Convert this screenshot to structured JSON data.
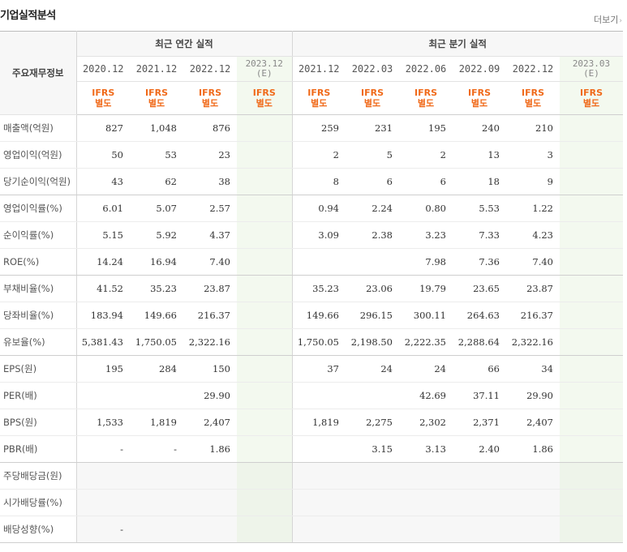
{
  "header": {
    "title": "기업실적분석",
    "more_label": "더보기"
  },
  "table": {
    "label_header": "주요재무정보",
    "annual_group": "최근 연간 실적",
    "quarter_group": "최근 분기 실적",
    "annual_dates": [
      "2020.12",
      "2021.12",
      "2022.12"
    ],
    "annual_est": [
      "2023.12",
      "(E)"
    ],
    "quarter_dates": [
      "2021.12",
      "2022.03",
      "2022.06",
      "2022.09",
      "2022.12"
    ],
    "quarter_est": [
      "2023.03",
      "(E)"
    ],
    "ifrs": [
      "IFRS",
      "별도"
    ],
    "rows": [
      {
        "label": "매출액(억원)",
        "values": [
          "827",
          "1,048",
          "876",
          "",
          "259",
          "231",
          "195",
          "240",
          "210",
          ""
        ]
      },
      {
        "label": "영업이익(억원)",
        "values": [
          "50",
          "53",
          "23",
          "",
          "2",
          "5",
          "2",
          "13",
          "3",
          ""
        ]
      },
      {
        "label": "당기순이익(억원)",
        "values": [
          "43",
          "62",
          "38",
          "",
          "8",
          "6",
          "6",
          "18",
          "9",
          ""
        ]
      },
      {
        "label": "영업이익률(%)",
        "values": [
          "6.01",
          "5.07",
          "2.57",
          "",
          "0.94",
          "2.24",
          "0.80",
          "5.53",
          "1.22",
          ""
        ]
      },
      {
        "label": "순이익률(%)",
        "values": [
          "5.15",
          "5.92",
          "4.37",
          "",
          "3.09",
          "2.38",
          "3.23",
          "7.33",
          "4.23",
          ""
        ]
      },
      {
        "label": "ROE(%)",
        "values": [
          "14.24",
          "16.94",
          "7.40",
          "",
          "",
          "",
          "7.98",
          "7.36",
          "7.40",
          ""
        ]
      },
      {
        "label": "부채비율(%)",
        "values": [
          "41.52",
          "35.23",
          "23.87",
          "",
          "35.23",
          "23.06",
          "19.79",
          "23.65",
          "23.87",
          ""
        ]
      },
      {
        "label": "당좌비율(%)",
        "values": [
          "183.94",
          "149.66",
          "216.37",
          "",
          "149.66",
          "296.15",
          "300.11",
          "264.63",
          "216.37",
          ""
        ]
      },
      {
        "label": "유보율(%)",
        "values": [
          "5,381.43",
          "1,750.05",
          "2,322.16",
          "",
          "1,750.05",
          "2,198.50",
          "2,222.35",
          "2,288.64",
          "2,322.16",
          ""
        ]
      },
      {
        "label": "EPS(원)",
        "values": [
          "195",
          "284",
          "150",
          "",
          "37",
          "24",
          "24",
          "66",
          "34",
          ""
        ]
      },
      {
        "label": "PER(배)",
        "values": [
          "",
          "",
          "29.90",
          "",
          "",
          "",
          "42.69",
          "37.11",
          "29.90",
          ""
        ]
      },
      {
        "label": "BPS(원)",
        "values": [
          "1,533",
          "1,819",
          "2,407",
          "",
          "1,819",
          "2,275",
          "2,302",
          "2,371",
          "2,407",
          ""
        ]
      },
      {
        "label": "PBR(배)",
        "values": [
          "-",
          "-",
          "1.86",
          "",
          "",
          "3.15",
          "3.13",
          "2.40",
          "1.86",
          ""
        ]
      },
      {
        "label": "주당배당금(원)",
        "values": [
          "",
          "",
          "",
          "",
          "",
          "",
          "",
          "",
          "",
          ""
        ]
      },
      {
        "label": "시가배당률(%)",
        "values": [
          "",
          "",
          "",
          "",
          "",
          "",
          "",
          "",
          "",
          ""
        ]
      },
      {
        "label": "배당성향(%)",
        "values": [
          "-",
          "",
          "",
          "",
          "",
          "",
          "",
          "",
          "",
          ""
        ]
      }
    ]
  },
  "colors": {
    "ifrs_accent": "#f06a1a",
    "estimate_bg": "#f3f9ef",
    "header_bg": "#f7f7f7"
  }
}
